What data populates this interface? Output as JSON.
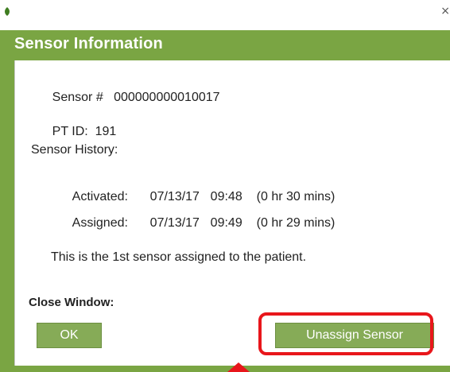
{
  "window": {
    "title": "Sensor Information",
    "close_symbol": "×",
    "app_icon": "leaf-icon"
  },
  "sensor": {
    "number_label": "Sensor #",
    "number_value": "000000000010017",
    "pt_id_label": "PT ID:",
    "pt_id_value": "191",
    "history_label": "Sensor History:",
    "activated_label": "Activated:",
    "activated_date": "07/13/17",
    "activated_time": "09:48",
    "activated_duration": "(0 hr 30 mins)",
    "assigned_label": "Assigned:",
    "assigned_date": "07/13/17",
    "assigned_time": "09:49",
    "assigned_duration": "(0 hr 29 mins)",
    "assignment_note": "This is the 1st sensor assigned to the patient."
  },
  "actions": {
    "close_window_label": "Close Window:",
    "ok_label": "OK",
    "unassign_label": "Unassign Sensor"
  },
  "colors": {
    "accent_green": "#7aa543",
    "button_green": "#86ab57",
    "highlight_red": "#e8161b"
  }
}
